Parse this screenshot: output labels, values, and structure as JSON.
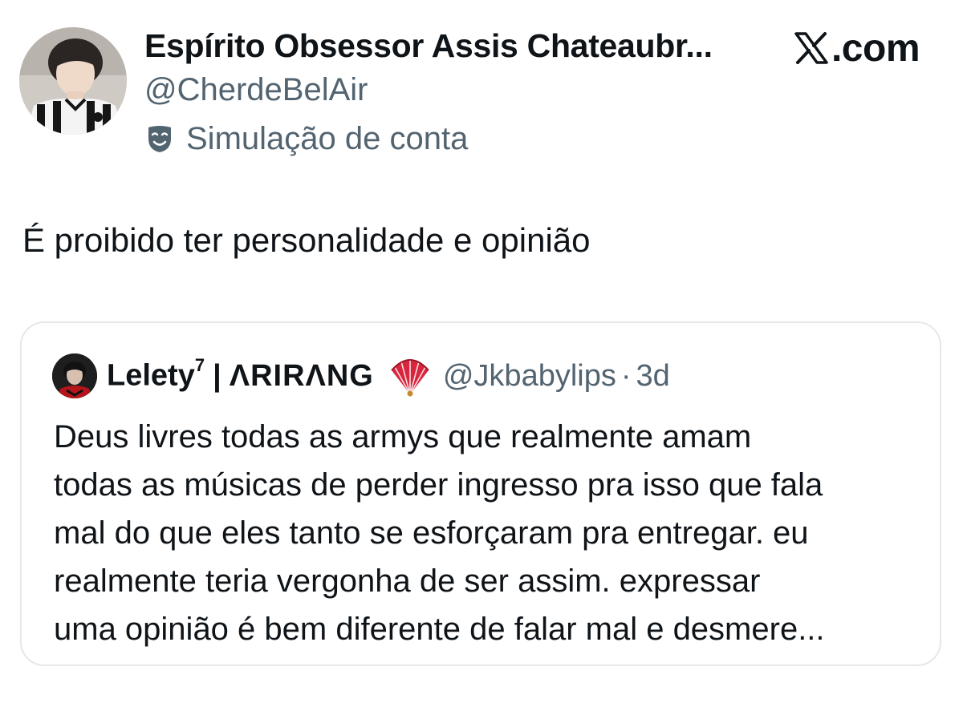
{
  "author": {
    "display_name": "Espírito Obsessor Assis Chateaubr...",
    "handle": "@CherdeBelAir",
    "parody_label": "Simulação de conta",
    "avatar_icon": "profile-photo"
  },
  "brand": {
    "logo_icon": "x-logo-icon",
    "text": ".com"
  },
  "tweet": {
    "text": "É proibido ter personalidade e opinião"
  },
  "quote": {
    "name": "Lelety",
    "name_superscript": "7",
    "separator": "|",
    "name_suffix": "ΛRIRΛNG",
    "emoji_icon": "folding-fan-icon",
    "handle": "@Jkbabylips",
    "dot": "·",
    "time": "3d",
    "lines": [
      "Deus livres todas as armys que realmente amam",
      "todas as músicas de perder ingresso pra isso que fala",
      "mal do que eles tanto se esforçaram pra entregar. eu",
      "realmente teria vergonha de ser assim. expressar",
      "uma opinião é bem diferente de falar mal e desmere..."
    ]
  },
  "colors": {
    "primary_text": "#0f1419",
    "secondary_text": "#536471",
    "card_border": "#e4e8eb"
  }
}
